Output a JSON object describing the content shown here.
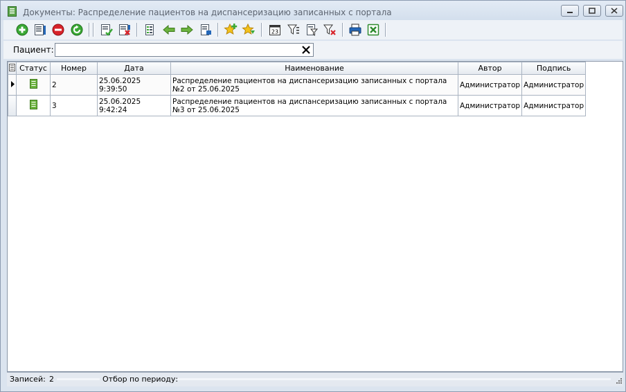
{
  "window": {
    "title": "Документы: Распределение пациентов на диспансеризацию записанных с портала"
  },
  "toolbar": {
    "buttons": [
      "add-icon",
      "edit-doc-icon",
      "delete-icon",
      "refresh-icon",
      "sign-doc-icon",
      "unsign-doc-icon",
      "properties-icon",
      "arrow-left-icon",
      "arrow-right-icon",
      "export-doc-icon",
      "favorite-add-icon",
      "favorite-down-icon",
      "calendar-icon",
      "filter-icon",
      "filter-edit-icon",
      "filter-clear-icon",
      "print-icon",
      "excel-icon"
    ]
  },
  "filter": {
    "label": "Пациент:",
    "value": "",
    "placeholder": ""
  },
  "table": {
    "columns": [
      "Статус",
      "Номер",
      "Дата",
      "Наименование",
      "Автор",
      "Подпись"
    ],
    "rows": [
      {
        "number": "2",
        "date": "25.06.2025 9:39:50",
        "name": "Распределение пациентов на диспансеризацию записанных с портала №2 от 25.06.2025",
        "author": "Администратор",
        "signature": "Администратор"
      },
      {
        "number": "3",
        "date": "25.06.2025 9:42:24",
        "name": "Распределение пациентов на диспансеризацию записанных с портала №3 от 25.06.2025",
        "author": "Администратор",
        "signature": "Администратор"
      }
    ]
  },
  "status": {
    "records_label": "Записей:",
    "records_value": "2",
    "period_label": "Отбор по периоду:",
    "period_value": ""
  },
  "colors": {
    "toolbar_green": "#3aa935",
    "toolbar_red": "#d8232a",
    "toolbar_blue": "#2467b8",
    "star_yellow": "#f3c21b"
  }
}
